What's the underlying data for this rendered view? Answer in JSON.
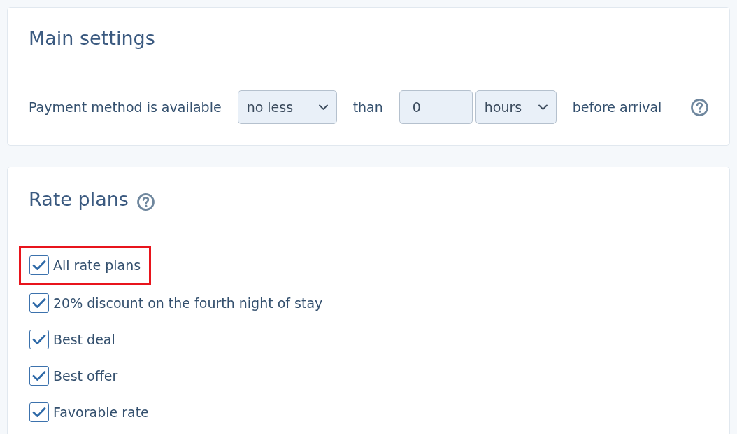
{
  "main_settings": {
    "title": "Main settings",
    "availability": {
      "label": "Payment method is available",
      "comparison": {
        "value": "no less"
      },
      "connector": "than",
      "amount": {
        "value": "0"
      },
      "unit": {
        "value": "hours"
      },
      "suffix": "before arrival"
    }
  },
  "rate_plans": {
    "title": "Rate plans",
    "items": [
      {
        "label": "All rate plans",
        "checked": true,
        "highlighted": true
      },
      {
        "label": "20% discount on the fourth night of stay",
        "checked": true,
        "highlighted": false
      },
      {
        "label": "Best deal",
        "checked": true,
        "highlighted": false
      },
      {
        "label": "Best offer",
        "checked": true,
        "highlighted": false
      },
      {
        "label": "Favorable rate",
        "checked": true,
        "highlighted": false
      }
    ]
  }
}
